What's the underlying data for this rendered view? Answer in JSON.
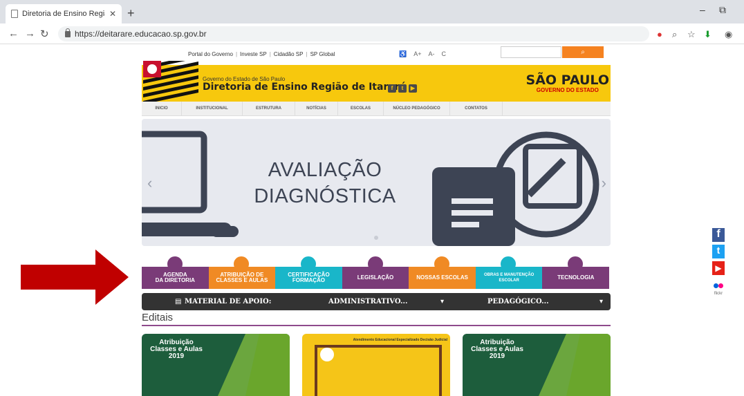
{
  "browser": {
    "tab_title": "Diretoria de Ensino Região de Itar",
    "url": "https://deitarare.educacao.sp.gov.br"
  },
  "top_links": [
    "Portal do Governo",
    "Investe SP",
    "Cidadão SP",
    "SP Global"
  ],
  "utilities": [
    "A+",
    "A-",
    "C"
  ],
  "banner": {
    "small": "Governo do Estado de São Paulo",
    "big": "Diretoria de Ensino Região de Itararé",
    "logo_main": "SÃO PAULO",
    "logo_sub": "GOVERNO DO ESTADO"
  },
  "menu": [
    "INICIO",
    "INSTITUCIONAL",
    "ESTRUTURA",
    "NOTÍCIAS",
    "ESCOLAS",
    "NÚCLEO PEDAGÓGICO",
    "CONTATOS"
  ],
  "slide": {
    "line1": "AVALIAÇÃO",
    "line2": "DIAGNÓSTICA"
  },
  "quick_links": [
    {
      "l1": "AGENDA",
      "l2": "DA DIRETORIA",
      "color": "#7a3b78"
    },
    {
      "l1": "ATRIBUIÇÃO DE",
      "l2": "CLASSES E AULAS",
      "color": "#f08a24"
    },
    {
      "l1": "CERTIFICAÇÃO",
      "l2": "FORMAÇÃO",
      "color": "#19b6c9"
    },
    {
      "l1": "LEGISLAÇÃO",
      "l2": "",
      "color": "#7a3b78"
    },
    {
      "l1": "NOSSAS ESCOLAS",
      "l2": "",
      "color": "#f08a24"
    },
    {
      "l1": "OBRAS E MANUTENÇÃO",
      "l2": "ESCOLAR",
      "color": "#19b6c9"
    },
    {
      "l1": "TECNOLOGIA",
      "l2": "",
      "color": "#7a3b78"
    }
  ],
  "material": {
    "label": "MATERIAL DE APOIO:",
    "admin": "ADMINISTRATIVO...",
    "ped": "PEDAGÓGICO..."
  },
  "editais_title": "Editais",
  "cards": [
    {
      "text": "Atribuição Classes e Aulas 2019"
    },
    {
      "text": "Atendimento Educacional Especializado Decisão Judicial"
    },
    {
      "text": "Atribuição Classes e Aulas 2019"
    }
  ],
  "social": [
    "f",
    "t",
    "▶",
    "flickr"
  ]
}
